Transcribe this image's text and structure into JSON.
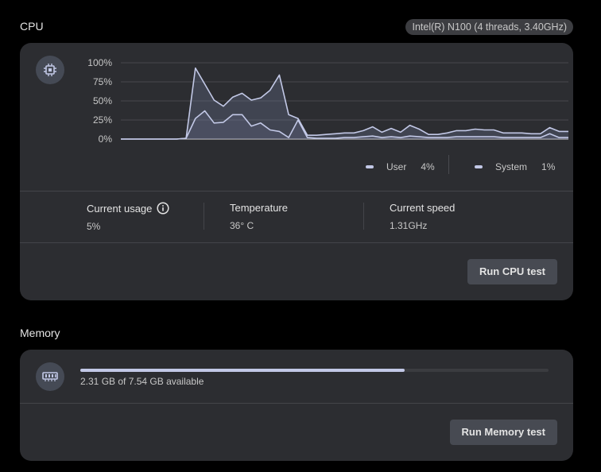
{
  "cpu": {
    "section_title": "CPU",
    "chip_label": "Intel(R) N100 (4 threads, 3.40GHz)",
    "icon": "cpu-chip-icon",
    "chart_data": {
      "type": "line",
      "title": "",
      "xlabel": "",
      "ylabel": "",
      "ylim": [
        0,
        100
      ],
      "y_ticks": [
        "100%",
        "75%",
        "50%",
        "25%",
        "0%"
      ],
      "grid": true,
      "legend": "bottom-right",
      "series": [
        {
          "name": "User",
          "color": "#c2c8e6",
          "values": [
            0,
            0,
            0,
            0,
            0,
            0,
            0,
            1,
            93,
            72,
            51,
            43,
            55,
            60,
            51,
            54,
            64,
            84,
            32,
            27,
            5,
            5,
            6,
            7,
            8,
            8,
            11,
            16,
            9,
            14,
            9,
            18,
            13,
            6,
            6,
            8,
            11,
            11,
            13,
            12,
            12,
            8,
            8,
            8,
            7,
            7,
            15,
            10,
            10
          ]
        },
        {
          "name": "System",
          "color": "#c2c8e6",
          "values": [
            0,
            0,
            0,
            0,
            0,
            0,
            0,
            1,
            27,
            37,
            21,
            22,
            32,
            32,
            17,
            21,
            12,
            10,
            2,
            25,
            2,
            1,
            1,
            1,
            2,
            2,
            3,
            4,
            2,
            3,
            2,
            4,
            3,
            2,
            2,
            2,
            3,
            3,
            3,
            3,
            3,
            2,
            2,
            2,
            2,
            2,
            7,
            2,
            2
          ]
        }
      ]
    },
    "legend": {
      "user_label": "User",
      "user_value": "4%",
      "system_label": "System",
      "system_value": "1%"
    },
    "stats": {
      "usage_label": "Current usage",
      "usage_value": "5%",
      "temp_label": "Temperature",
      "temp_value": "36° C",
      "speed_label": "Current speed",
      "speed_value": "1.31GHz"
    },
    "test_button": "Run CPU test"
  },
  "memory": {
    "section_title": "Memory",
    "icon": "memory-module-icon",
    "usage_fraction": 0.693,
    "available_text": "2.31 GB of 7.54 GB available",
    "test_button": "Run Memory test"
  },
  "colors": {
    "background": "#000000",
    "card": "#2c2d31",
    "accent": "#c2c8e6",
    "button": "#474a52"
  }
}
